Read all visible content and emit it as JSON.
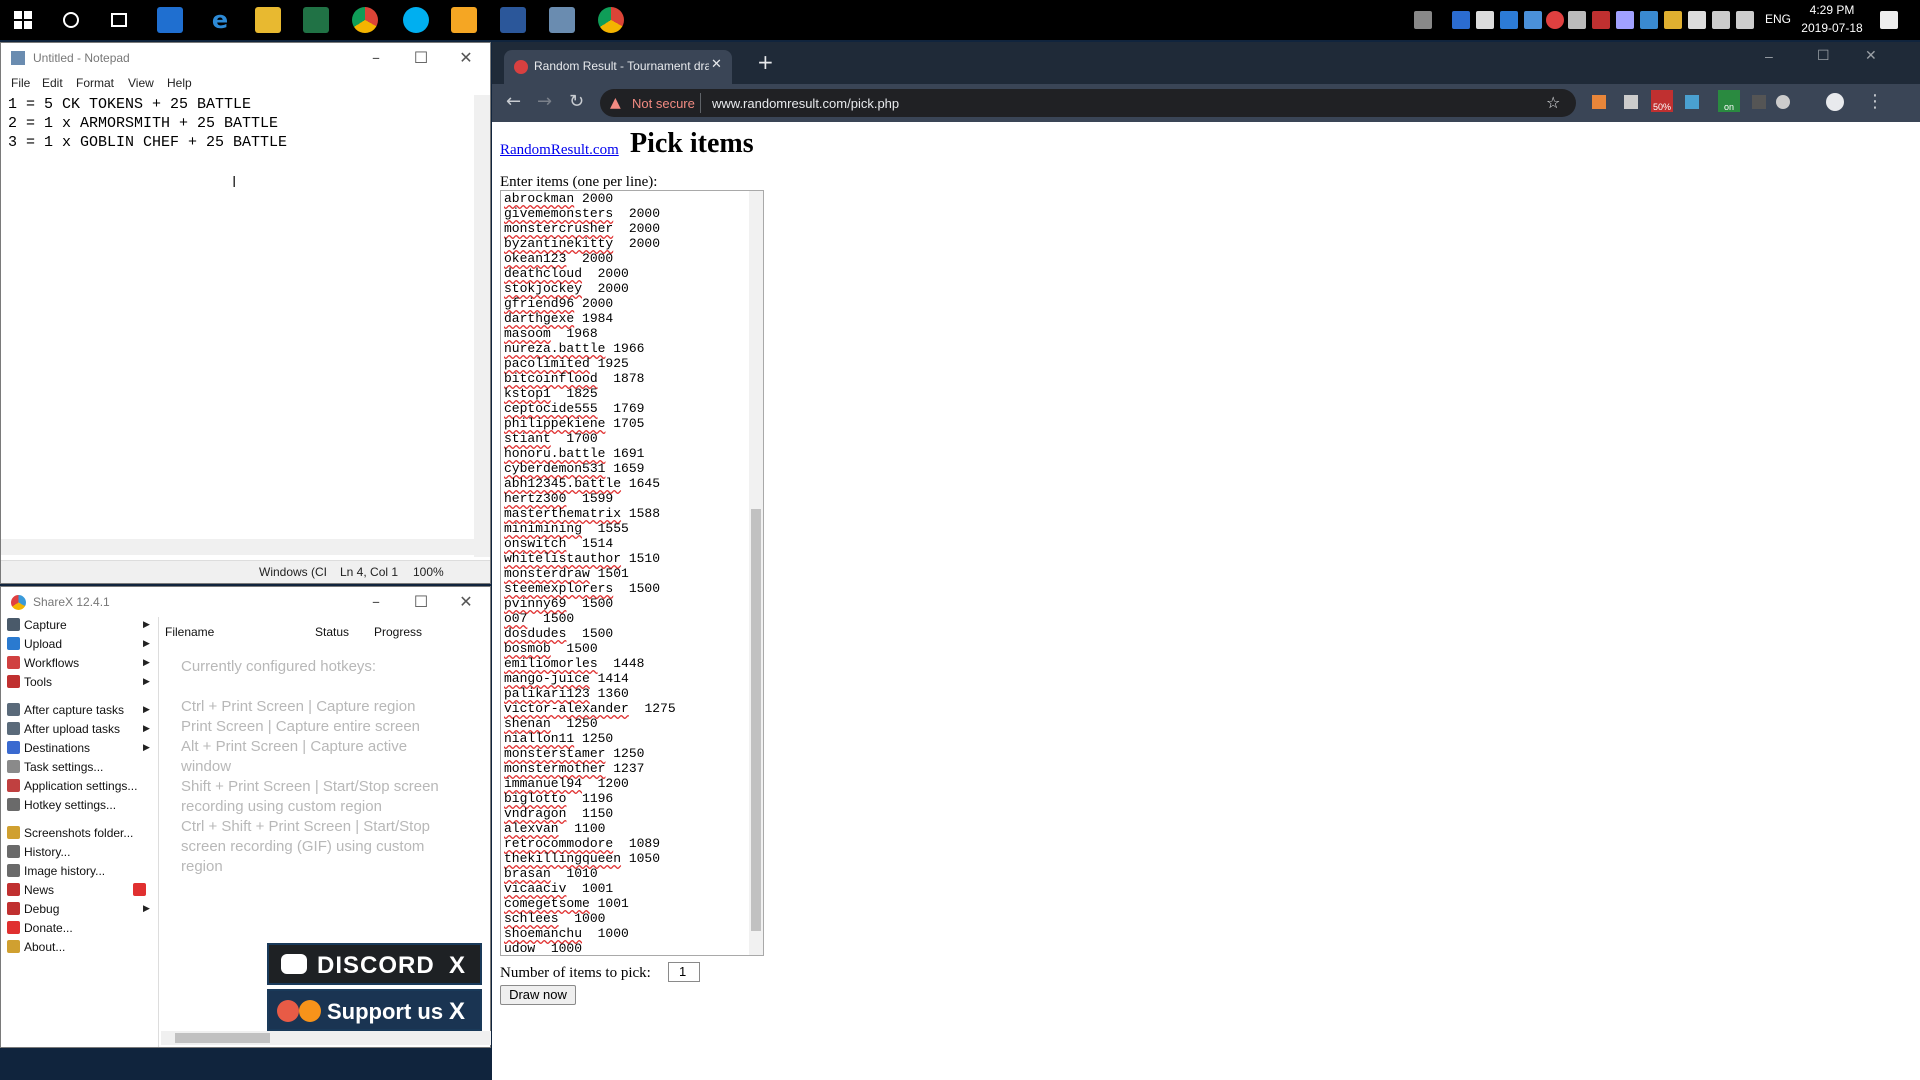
{
  "taskbar": {
    "time": "4:29 PM",
    "date": "2019-07-18",
    "language": "ENG"
  },
  "notepad": {
    "title": "Untitled - Notepad",
    "menu": [
      "File",
      "Edit",
      "Format",
      "View",
      "Help"
    ],
    "lines": [
      "1 = 5 CK TOKENS + 25 BATTLE",
      "2 = 1 x ARMORSMITH + 25 BATTLE",
      "3 = 1 x GOBLIN CHEF + 25 BATTLE"
    ],
    "status": {
      "encoding": "Windows (CI",
      "position": "Ln 4, Col 1",
      "zoom": "100%"
    }
  },
  "sharex": {
    "title": "ShareX 12.4.1",
    "menu": [
      {
        "label": "Capture",
        "color": "#4a5a6a",
        "arrow": true
      },
      {
        "label": "Upload",
        "color": "#2a7ad0",
        "arrow": true
      },
      {
        "label": "Workflows",
        "color": "#d04040",
        "arrow": true
      },
      {
        "label": "Tools",
        "color": "#c03030",
        "arrow": true
      },
      {
        "label": "After capture tasks",
        "color": "#5a6a7a",
        "arrow": true
      },
      {
        "label": "After upload tasks",
        "color": "#5a6a7a",
        "arrow": true
      },
      {
        "label": "Destinations",
        "color": "#3a6ad0",
        "arrow": true
      },
      {
        "label": "Task settings...",
        "color": "#8a8a8a",
        "arrow": false
      },
      {
        "label": "Application settings...",
        "color": "#c04040",
        "arrow": false
      },
      {
        "label": "Hotkey settings...",
        "color": "#6a6a6a",
        "arrow": false
      },
      {
        "label": "Screenshots folder...",
        "color": "#d0a030",
        "arrow": false
      },
      {
        "label": "History...",
        "color": "#6a6a6a",
        "arrow": false
      },
      {
        "label": "Image history...",
        "color": "#6a6a6a",
        "arrow": false
      },
      {
        "label": "News",
        "color": "#c03030",
        "arrow": false
      },
      {
        "label": "Debug",
        "color": "#c03030",
        "arrow": true
      },
      {
        "label": "Donate...",
        "color": "#e03030",
        "arrow": false
      },
      {
        "label": "About...",
        "color": "#d0a030",
        "arrow": false
      }
    ],
    "columns": [
      "Filename",
      "Status",
      "Progress"
    ],
    "hotkeys_heading": "Currently configured hotkeys:",
    "hotkeys": [
      "Ctrl + Print Screen  |  Capture region",
      "Print Screen  |  Capture entire screen",
      "Alt + Print Screen  |  Capture active window",
      "Shift + Print Screen  |  Start/Stop screen recording using custom region",
      "Ctrl + Shift + Print Screen  |  Start/Stop screen recording (GIF) using custom region"
    ],
    "discord_label": "DISCORD",
    "support_label": "Support us",
    "close_label": "X"
  },
  "browser": {
    "tab_title": "Random Result - Tournament dra",
    "security_label": "Not secure",
    "url": "www.randomresult.com/pick.php",
    "extension_badge_a": "50%",
    "extension_badge_b": "on"
  },
  "page": {
    "site_link": "RandomResult.com",
    "title": "Pick items",
    "enter_label": "Enter items (one per line):",
    "items": [
      [
        "abrockman",
        "2000"
      ],
      [
        "givememonsters",
        "2000"
      ],
      [
        "monstercrusher",
        "2000"
      ],
      [
        "byzantinekitty",
        "2000"
      ],
      [
        "okean123",
        "2000"
      ],
      [
        "deathcloud",
        "2000"
      ],
      [
        "stokjockey",
        "2000"
      ],
      [
        "gfriend96",
        "2000"
      ],
      [
        "darthgexe",
        "1984"
      ],
      [
        "masoom",
        "1968"
      ],
      [
        "nureza.battle",
        "1966"
      ],
      [
        "pacolimited",
        "1925"
      ],
      [
        "bitcoinflood",
        "1878"
      ],
      [
        "kstop1",
        "1825"
      ],
      [
        "ceptocide555",
        "1769"
      ],
      [
        "philippekiene",
        "1705"
      ],
      [
        "stiant",
        "1700"
      ],
      [
        "honoru.battle",
        "1691"
      ],
      [
        "cyberdemon531",
        "1659"
      ],
      [
        "abh12345.battle",
        "1645"
      ],
      [
        "hertz300",
        "1599"
      ],
      [
        "masterthematrix",
        "1588"
      ],
      [
        "minimining",
        "1555"
      ],
      [
        "onswitch",
        "1514"
      ],
      [
        "whitelistauthor",
        "1510"
      ],
      [
        "monsterdraw",
        "1501"
      ],
      [
        "steemexplorers",
        "1500"
      ],
      [
        "pvinny69",
        "1500"
      ],
      [
        "o07",
        "1500"
      ],
      [
        "dosdudes",
        "1500"
      ],
      [
        "bosmob",
        "1500"
      ],
      [
        "emiliomorles",
        "1448"
      ],
      [
        "mango-juice",
        "1414"
      ],
      [
        "palikari123",
        "1360"
      ],
      [
        "victor-alexander",
        "1275"
      ],
      [
        "shenan",
        "1250"
      ],
      [
        "niallon11",
        "1250"
      ],
      [
        "monsterstamer",
        "1250"
      ],
      [
        "monstermother",
        "1237"
      ],
      [
        "immanuel94",
        "1200"
      ],
      [
        "biglotto",
        "1196"
      ],
      [
        "vndragon",
        "1150"
      ],
      [
        "alexvan",
        "1100"
      ],
      [
        "retrocommodore",
        "1089"
      ],
      [
        "thekillingqueen",
        "1050"
      ],
      [
        "brasan",
        "1010"
      ],
      [
        "vicaaciv",
        "1001"
      ],
      [
        "comegetsome",
        "1001"
      ],
      [
        "schlees",
        "1000"
      ],
      [
        "shoemanchu",
        "1000"
      ],
      [
        "udow",
        "1000"
      ]
    ],
    "pick_label": "Number of items to pick:",
    "pick_value": "1",
    "draw_button": "Draw now"
  }
}
